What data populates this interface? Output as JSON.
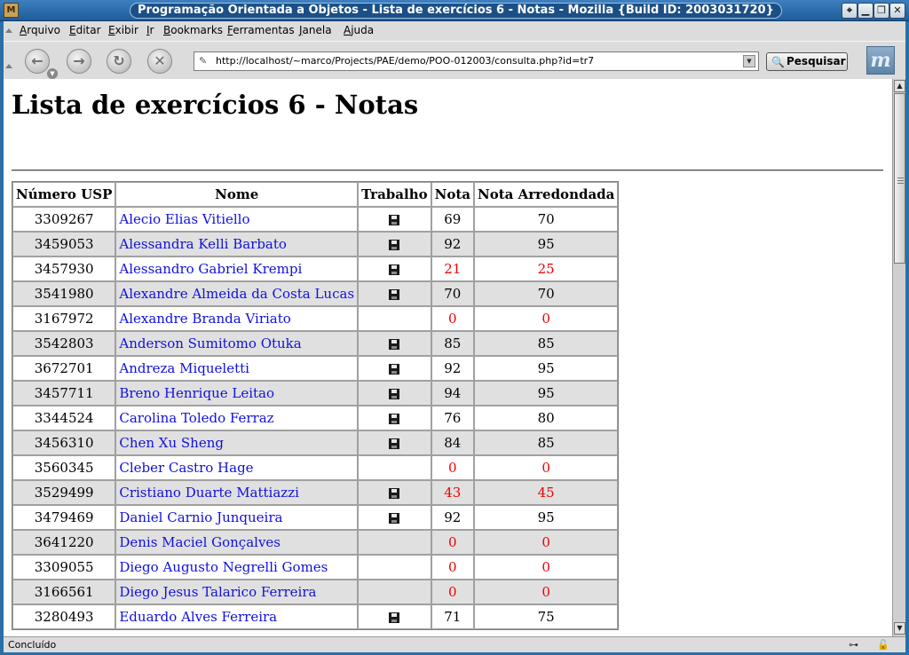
{
  "window": {
    "title": "Programação Orientada a Objetos - Lista de exercícios 6 - Notas - Mozilla {Build ID: 2003031720}",
    "buttons": [
      "⌖",
      "▁",
      "❐",
      "✕"
    ]
  },
  "menu": {
    "items": [
      "Arquivo",
      "Editar",
      "Exibir",
      "Ir",
      "Bookmarks",
      "Ferramentas",
      "Janela",
      "Ajuda"
    ]
  },
  "nav": {
    "url": "http://localhost/~marco/Projects/PAE/demo/POO-012003/consulta.php?id=tr7",
    "search_label": "Pesquisar",
    "back_icon": "back-arrow",
    "forward_icon": "forward-arrow",
    "reload_icon": "reload",
    "stop_icon": "stop"
  },
  "page": {
    "heading": "Lista de exercícios 6 - Notas"
  },
  "table": {
    "headers": [
      "Número USP",
      "Nome",
      "Trabalho",
      "Nota",
      "Nota Arredondada"
    ],
    "rows": [
      {
        "usp": "3309267",
        "name": "Alecio Elias Vitiello",
        "file": true,
        "nota": "69",
        "arred": "70",
        "fail": false
      },
      {
        "usp": "3459053",
        "name": "Alessandra Kelli Barbato",
        "file": true,
        "nota": "92",
        "arred": "95",
        "fail": false
      },
      {
        "usp": "3457930",
        "name": "Alessandro Gabriel Krempi",
        "file": true,
        "nota": "21",
        "arred": "25",
        "fail": true
      },
      {
        "usp": "3541980",
        "name": "Alexandre Almeida da Costa Lucas",
        "file": true,
        "nota": "70",
        "arred": "70",
        "fail": false
      },
      {
        "usp": "3167972",
        "name": "Alexandre Branda Viriato",
        "file": false,
        "nota": "0",
        "arred": "0",
        "fail": true
      },
      {
        "usp": "3542803",
        "name": "Anderson Sumitomo Otuka",
        "file": true,
        "nota": "85",
        "arred": "85",
        "fail": false
      },
      {
        "usp": "3672701",
        "name": "Andreza Miqueletti",
        "file": true,
        "nota": "92",
        "arred": "95",
        "fail": false
      },
      {
        "usp": "3457711",
        "name": "Breno Henrique Leitao",
        "file": true,
        "nota": "94",
        "arred": "95",
        "fail": false
      },
      {
        "usp": "3344524",
        "name": "Carolina Toledo Ferraz",
        "file": true,
        "nota": "76",
        "arred": "80",
        "fail": false
      },
      {
        "usp": "3456310",
        "name": "Chen Xu Sheng",
        "file": true,
        "nota": "84",
        "arred": "85",
        "fail": false
      },
      {
        "usp": "3560345",
        "name": "Cleber Castro Hage",
        "file": false,
        "nota": "0",
        "arred": "0",
        "fail": true
      },
      {
        "usp": "3529499",
        "name": "Cristiano Duarte Mattiazzi",
        "file": true,
        "nota": "43",
        "arred": "45",
        "fail": true
      },
      {
        "usp": "3479469",
        "name": "Daniel Carnio Junqueira",
        "file": true,
        "nota": "92",
        "arred": "95",
        "fail": false
      },
      {
        "usp": "3641220",
        "name": "Denis Maciel Gonçalves",
        "file": false,
        "nota": "0",
        "arred": "0",
        "fail": true
      },
      {
        "usp": "3309055",
        "name": "Diego Augusto Negrelli Gomes",
        "file": false,
        "nota": "0",
        "arred": "0",
        "fail": true
      },
      {
        "usp": "3166561",
        "name": "Diego Jesus Talarico Ferreira",
        "file": false,
        "nota": "0",
        "arred": "0",
        "fail": true
      },
      {
        "usp": "3280493",
        "name": "Eduardo Alves Ferreira",
        "file": true,
        "nota": "71",
        "arred": "75",
        "fail": false
      }
    ]
  },
  "status": {
    "text": "Concluído"
  },
  "colors": {
    "link": "#1010e0",
    "fail": "#ee0000",
    "row_alt": "#e0e0e0"
  }
}
